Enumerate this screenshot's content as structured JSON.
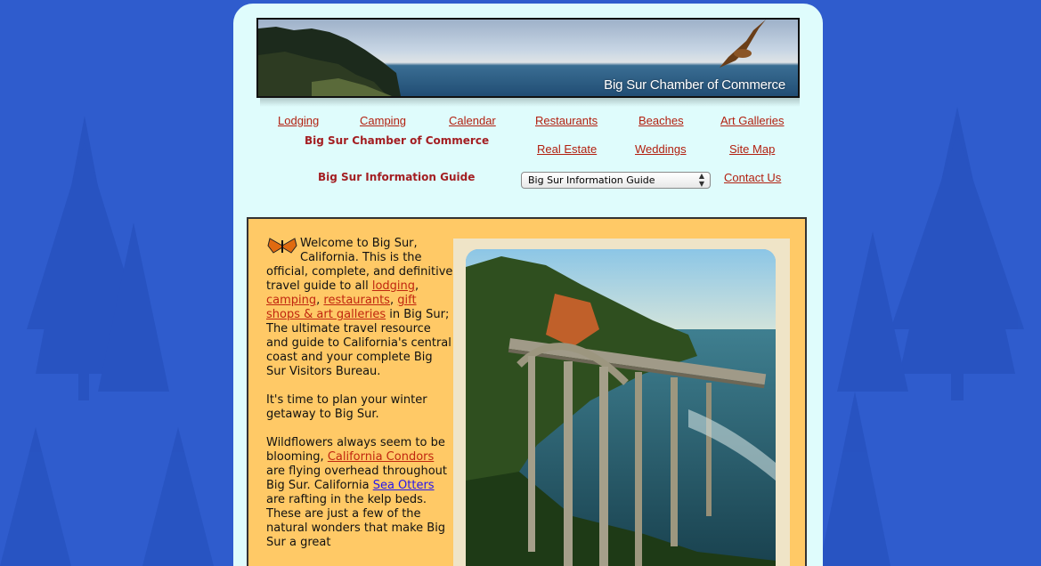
{
  "banner": {
    "title": "Big Sur Chamber of Commerce"
  },
  "nav": {
    "row1": [
      "Lodging",
      "Camping",
      "Calendar",
      "Restaurants",
      "Beaches",
      "Art Galleries"
    ],
    "row2": [
      "Real Estate",
      "Weddings",
      "Site Map"
    ],
    "contact": "Contact Us"
  },
  "subtitles": {
    "chamber": "Big Sur Chamber of Commerce",
    "guide": "Big Sur Information Guide"
  },
  "select": {
    "value": "Big Sur Information Guide"
  },
  "content": {
    "intro_before": "Welcome to Big Sur, California. This is the official, complete, and definitive travel guide to all ",
    "link_lodging": "lodging",
    "link_camping": "camping",
    "link_restaurants": "restaurants",
    "link_gifts": "gift shops & art galleries",
    "intro_after": " in Big Sur; The ultimate travel resource and guide to California's central coast and your complete Big Sur Visitors Bureau.",
    "para2": "It's time to plan your winter getaway to Big Sur.",
    "para3_before": "Wildflowers always seem to be blooming, ",
    "link_condors": "California Condors",
    "para3_mid": " are flying overhead throughout Big Sur. California ",
    "link_otters": "Sea Otters",
    "para3_after": " are rafting in the kelp beds. These are just a few of the natural wonders that make Big Sur a great"
  },
  "colors": {
    "background": "#2f5ccd",
    "page": "#dffcfc",
    "content": "#ffc966",
    "link": "#b22010",
    "visited_link": "#2415ee"
  }
}
